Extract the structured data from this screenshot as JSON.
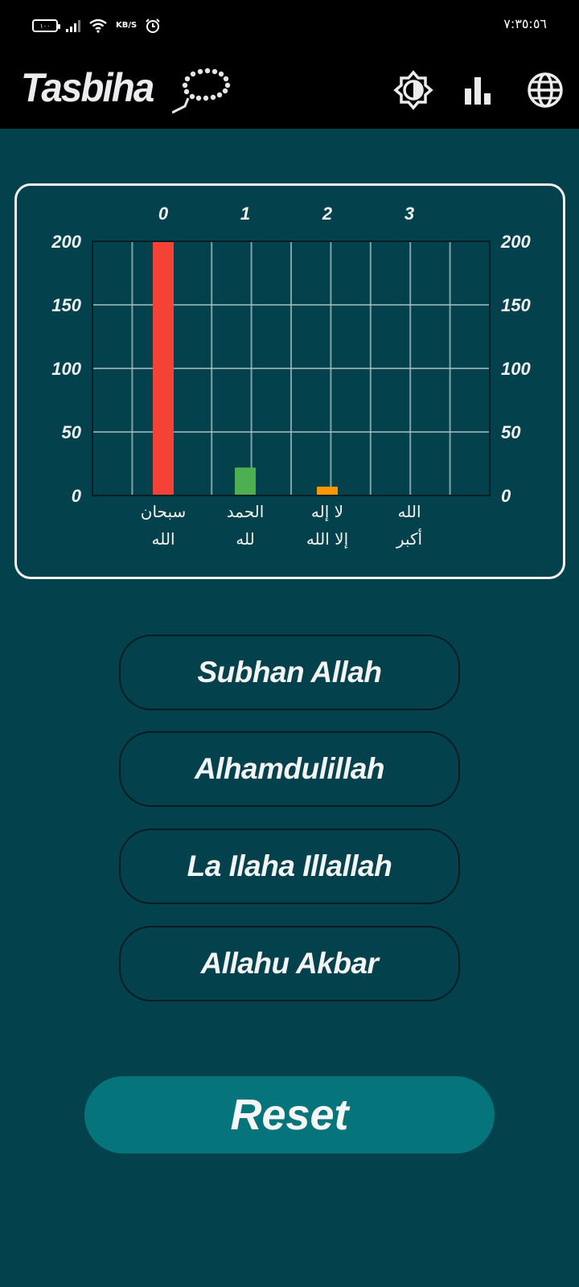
{
  "status_bar": {
    "battery": "١٠٠",
    "speed_unit": "KB/S",
    "time": "٧:٣٥:٥٦"
  },
  "app_bar": {
    "title": "Tasbiha",
    "icons": [
      "prayer-beads-icon",
      "brightness-icon",
      "bar-chart-icon",
      "globe-icon"
    ]
  },
  "chart_data": {
    "type": "bar",
    "x_top_labels": [
      "0",
      "1",
      "2",
      "3"
    ],
    "categories": [
      [
        "سبحان",
        "الله"
      ],
      [
        "الحمد",
        "لله"
      ],
      [
        "لا إله",
        "إلا الله"
      ],
      [
        "الله",
        "أكبر"
      ]
    ],
    "values": [
      200,
      22,
      7,
      0
    ],
    "colors": [
      "#f44336",
      "#4caf50",
      "#ff9800",
      "#2196f3"
    ],
    "ylim": [
      0,
      200
    ],
    "y_ticks": [
      "0",
      "50",
      "100",
      "150",
      "200"
    ],
    "grid": true,
    "y_axis_both_sides": true
  },
  "buttons": {
    "subhan": "Subhan Allah",
    "alhamd": "Alhamdulillah",
    "lailaha": "La Ilaha Illallah",
    "akbar": "Allahu Akbar",
    "reset": "Reset"
  }
}
